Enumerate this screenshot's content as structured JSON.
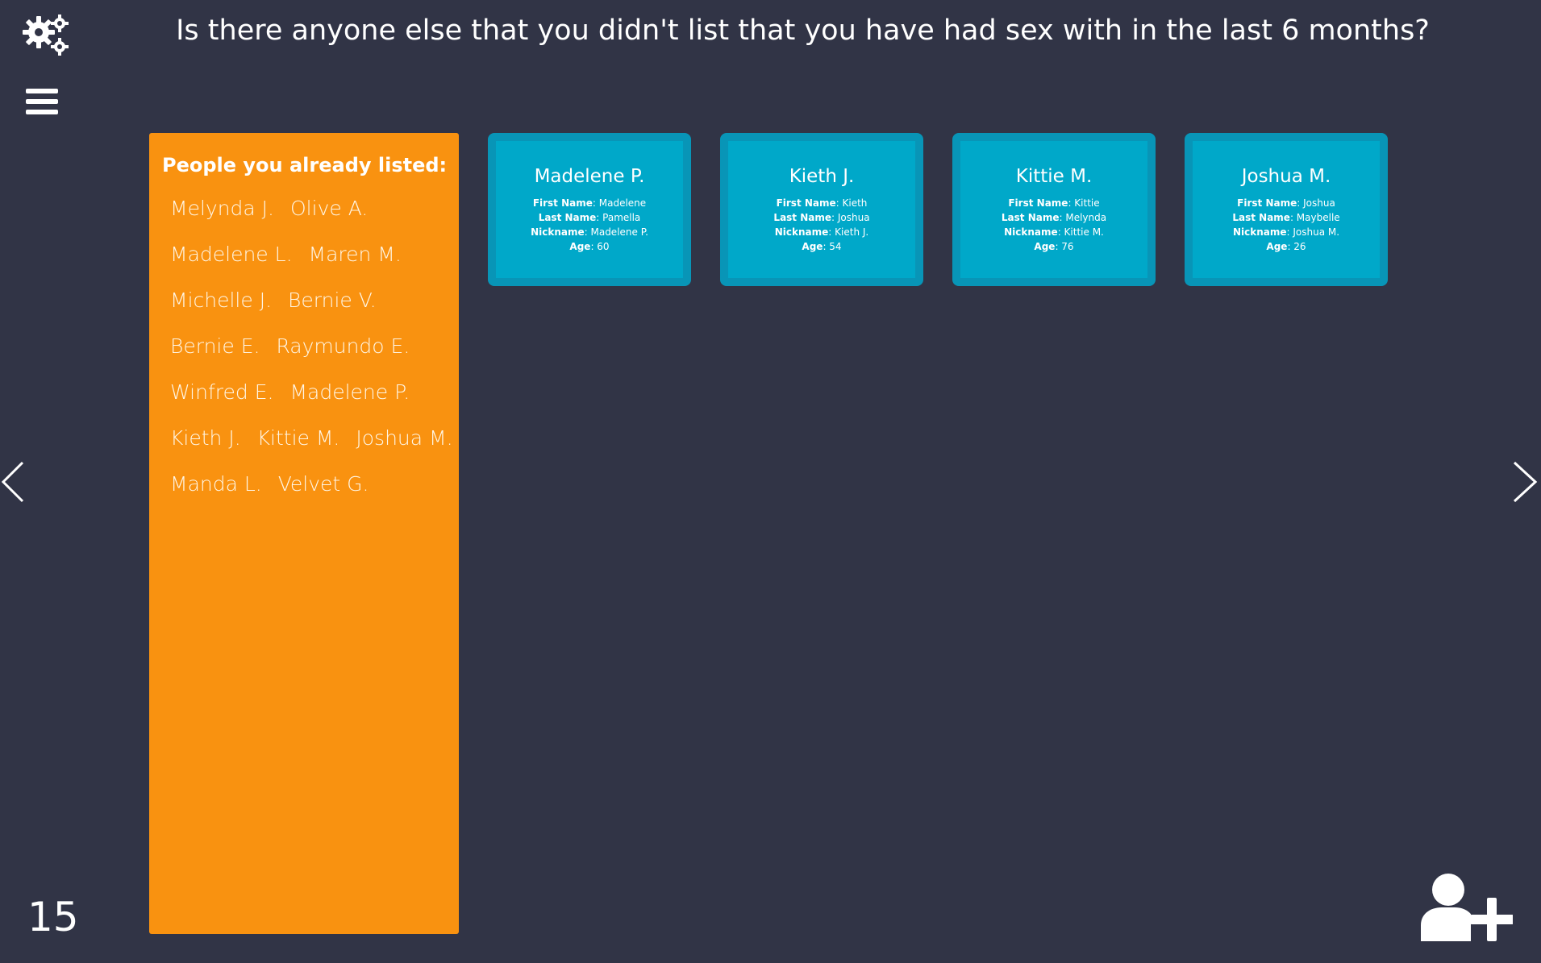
{
  "header": {
    "question": "Is there anyone else that you didn't list that you have had sex with in the last 6 months?"
  },
  "toolbar": {
    "settings_icon": "gears-icon",
    "menu_icon": "hamburger-menu-icon"
  },
  "listed_panel": {
    "title": "People you already listed:",
    "rows": [
      [
        "Melynda J.",
        "Olive A."
      ],
      [
        "Madelene L.",
        "Maren M."
      ],
      [
        "Michelle J.",
        "Bernie V."
      ],
      [
        "Bernie E.",
        "Raymundo E."
      ],
      [
        "Winfred E.",
        "Madelene P."
      ],
      [
        "Kieth J.",
        "Kittie M.",
        "Joshua M."
      ],
      [
        "Manda L.",
        "Velvet G."
      ]
    ]
  },
  "field_labels": {
    "first": "First Name",
    "last": "Last Name",
    "nick": "Nickname",
    "age": "Age"
  },
  "cards": [
    {
      "name": "Madelene P.",
      "first": "Madelene",
      "last": "Pamella",
      "nick": "Madelene P.",
      "age": "60"
    },
    {
      "name": "Kieth J.",
      "first": "Kieth",
      "last": "Joshua",
      "nick": "Kieth J.",
      "age": "54"
    },
    {
      "name": "Kittie M.",
      "first": "Kittie",
      "last": "Melynda",
      "nick": "Kittie M.",
      "age": "76"
    },
    {
      "name": "Joshua M.",
      "first": "Joshua",
      "last": "Maybelle",
      "nick": "Joshua M.",
      "age": "26"
    }
  ],
  "footer": {
    "page_number": "15",
    "add_icon": "add-person-icon"
  },
  "colors": {
    "background": "#313446",
    "panel": "#f99210",
    "card_border": "#0895b7",
    "card_fill": "#00a8c9"
  }
}
